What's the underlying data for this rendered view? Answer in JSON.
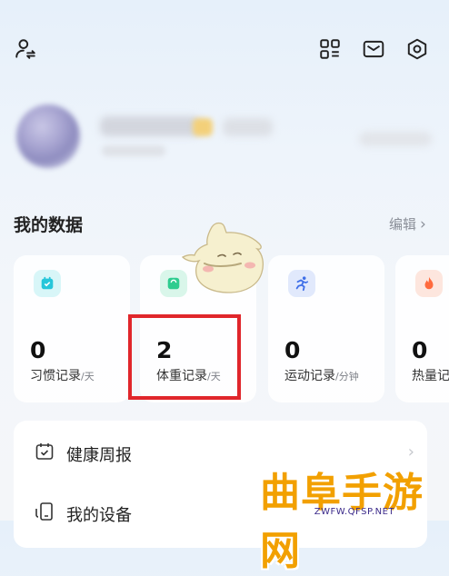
{
  "header": {
    "icons": [
      "profile-switch-icon",
      "grid-icon",
      "mail-icon",
      "settings-icon"
    ]
  },
  "section": {
    "title": "我的数据",
    "edit_label": "编辑"
  },
  "cards": [
    {
      "icon": "habit-icon",
      "color": "#26c6da",
      "value": "0",
      "label": "习惯记录",
      "unit": "/天"
    },
    {
      "icon": "weight-icon",
      "color": "#2ecc8f",
      "value": "2",
      "label": "体重记录",
      "unit": "/天"
    },
    {
      "icon": "run-icon",
      "color": "#3f6fe8",
      "value": "0",
      "label": "运动记录",
      "unit": "/分钟"
    },
    {
      "icon": "flame-icon",
      "color": "#ff6a3d",
      "value": "0",
      "label": "热量记",
      "unit": ""
    }
  ],
  "list": [
    {
      "icon": "calendar-icon",
      "label": "健康周报"
    },
    {
      "icon": "device-icon",
      "label": "我的设备"
    }
  ],
  "watermark": {
    "text": "曲阜手游网",
    "url": "ZWFW.QFSP.NET"
  }
}
